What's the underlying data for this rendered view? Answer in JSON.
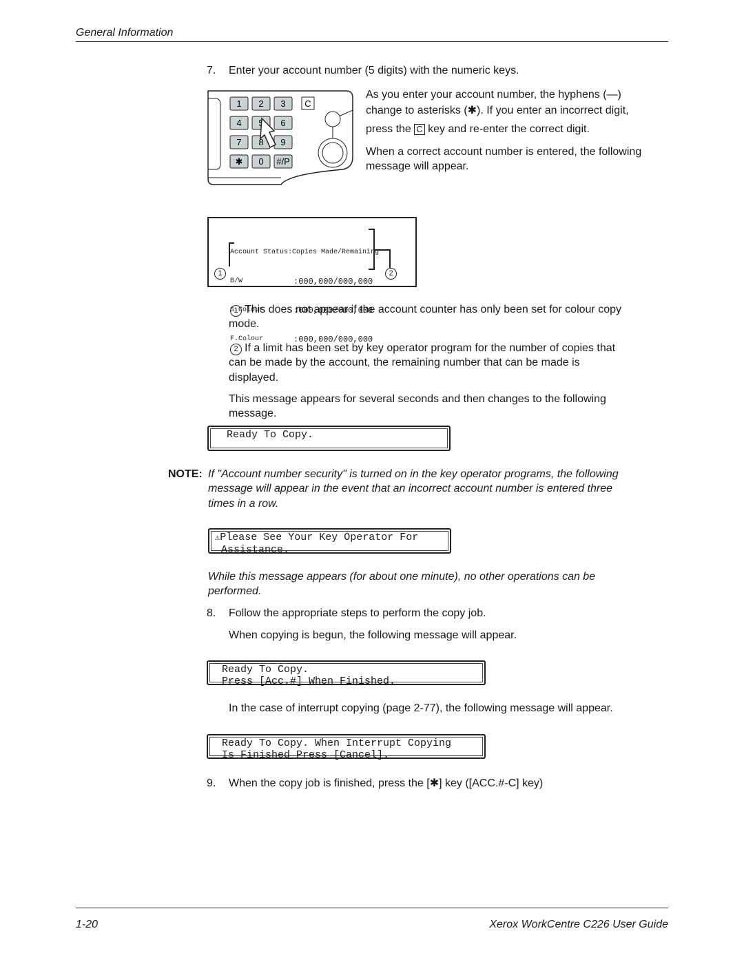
{
  "header": {
    "section": "General Information"
  },
  "step7": {
    "number": "7.",
    "text": "Enter your account number (5 digits) with the numeric keys.",
    "side_lines": [
      "As you enter your account number, the hyphens (—)",
      "change to asterisks (✱). If you enter an incorrect digit,",
      "press the",
      "key and re-enter the correct digit.",
      "When a correct account number is entered, the following",
      "message will appear."
    ],
    "c_key": "C"
  },
  "keypad": {
    "keys": [
      "1",
      "2",
      "3",
      "4",
      "5",
      "6",
      "7",
      "8",
      "9",
      "✱",
      "0",
      "#/P"
    ],
    "clear": "C"
  },
  "display": {
    "title": "Account Status:Copies Made/Remaining",
    "rows": [
      {
        "label": "B/W",
        "value": ":000,000/000,000"
      },
      {
        "label": "S.Colour",
        "value": ":000,000/000,000"
      },
      {
        "label": "F.Colour",
        "value": ":000,000/000,000"
      }
    ],
    "marker1": "1",
    "marker2": "2"
  },
  "notes": {
    "n1_marker": "1",
    "n1": [
      "This does not appear if the account counter has only been set for colour copy",
      "mode."
    ],
    "n2_marker": "2",
    "n2": [
      "If a limit has been set by key operator program for the number of copies that",
      "can be made by the account, the remaining number that can be made is",
      "displayed."
    ],
    "after": [
      "This message appears for several seconds and then changes to the following",
      "message."
    ]
  },
  "msg_ready": "Ready To Copy.",
  "note": {
    "label": "NOTE:",
    "lines": [
      "If \"Account number security\" is turned on in the key operator programs, the following",
      "message will appear in the event that an incorrect account number is entered three",
      "times in a row."
    ]
  },
  "msg_warning": {
    "line1": "Please See Your Key Operator For",
    "line2": "Assistance."
  },
  "while": [
    "While this message appears (for about one minute), no other operations can be",
    "performed."
  ],
  "step8": {
    "number": "8.",
    "text": "Follow the appropriate steps to perform the copy job.",
    "sub": "When copying is begun, the following message will appear."
  },
  "msg_copying": {
    "line1": "Ready To Copy.",
    "line2": "Press [Acc.#] When Finished."
  },
  "interrupt_text": "In the case of interrupt copying (page 2-77), the following message will appear.",
  "msg_interrupt": {
    "line1": "Ready To Copy. When Interrupt Copying",
    "line2": "Is Finished Press [Cancel]."
  },
  "step9": {
    "number": "9.",
    "text": "When the copy job is finished, press the [✱] key ([ACC.#-C] key)"
  },
  "footer": {
    "page": "1-20",
    "title": "Xerox WorkCentre C226 User Guide"
  }
}
